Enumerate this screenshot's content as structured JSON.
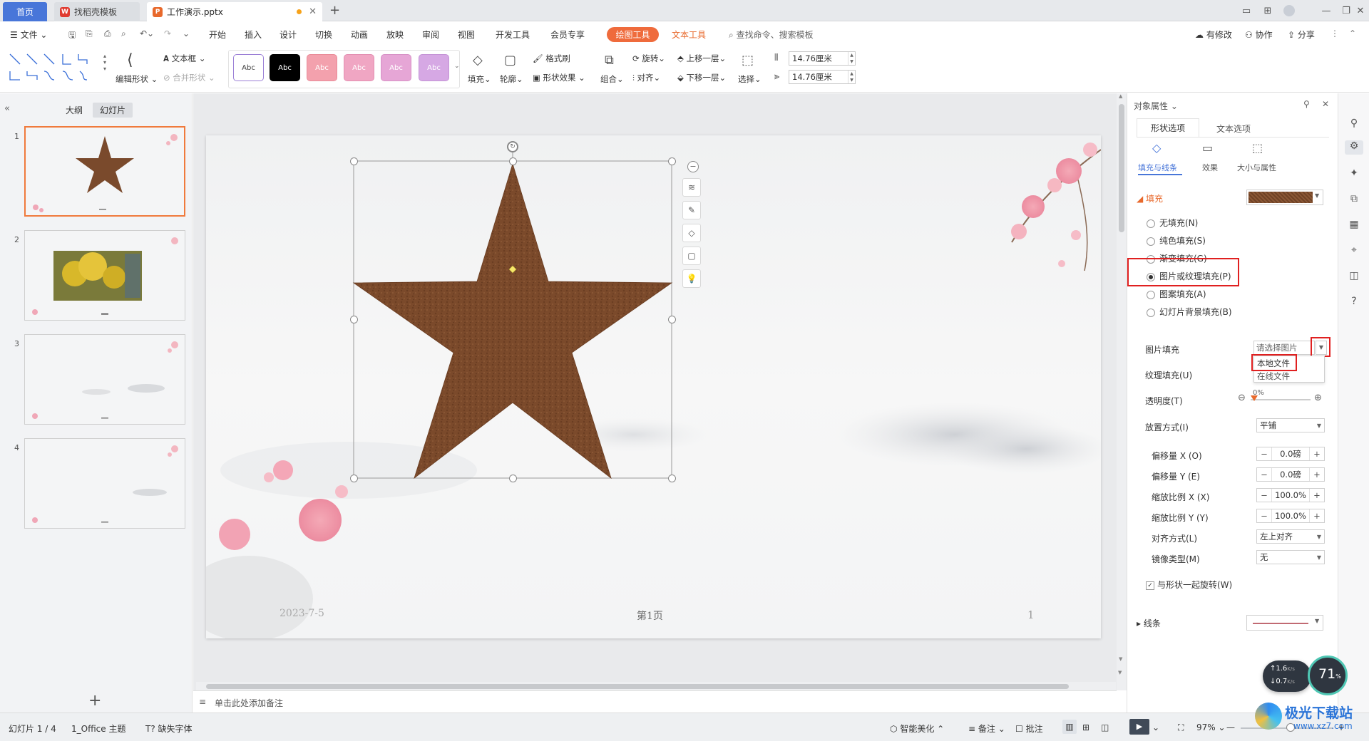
{
  "tabs": {
    "home": "首页",
    "template": "找稻壳模板",
    "doc": "工作演示.pptx",
    "add": "+"
  },
  "menu": {
    "file": "文件",
    "items": [
      "开始",
      "插入",
      "设计",
      "切换",
      "动画",
      "放映",
      "审阅",
      "视图",
      "开发工具",
      "会员专享"
    ],
    "drawing_tools": "绘图工具",
    "text_tools": "文本工具",
    "search_placeholder": "查找命令、搜索模板",
    "modified": "有修改",
    "collab": "协作",
    "share": "分享"
  },
  "ribbon": {
    "edit_shape": "编辑形状",
    "textbox": "文本框",
    "merge_shape": "合并形状",
    "styles": [
      "Abc",
      "Abc",
      "Abc",
      "Abc",
      "Abc",
      "Abc"
    ],
    "fill": "填充",
    "outline": "轮廓",
    "format_brush": "格式刷",
    "shape_effect": "形状效果",
    "group": "组合",
    "rotate": "旋转",
    "align": "对齐",
    "bring_forward": "上移一层",
    "send_backward": "下移一层",
    "select": "选择",
    "height": "14.76厘米",
    "width": "14.76厘米"
  },
  "left_panel": {
    "outline_tab": "大纲",
    "slides_tab": "幻灯片",
    "slide_numbers": [
      "1",
      "2",
      "3",
      "4"
    ],
    "add": "+"
  },
  "slide": {
    "date": "2023-7-5",
    "page_label": "第1页",
    "page_number": "1"
  },
  "notes": {
    "placeholder": "单击此处添加备注"
  },
  "right_panel": {
    "title": "对象属性",
    "tab_shape": "形状选项",
    "tab_text": "文本选项",
    "sub_fill_line": "填充与线条",
    "sub_effect": "效果",
    "sub_size": "大小与属性",
    "fill_section": "填充",
    "fill_options": [
      "无填充(N)",
      "纯色填充(S)",
      "渐变填充(G)",
      "图片或纹理填充(P)",
      "图案填充(A)",
      "幻灯片背景填充(B)"
    ],
    "picture_fill": "图片填充",
    "picture_fill_value": "请选择图片",
    "dropdown_local": "本地文件",
    "dropdown_online": "在线文件",
    "texture_fill": "纹理填充(U)",
    "transparency": "透明度(T)",
    "transparency_value": "0%",
    "placement": "放置方式(I)",
    "placement_value": "平铺",
    "offset_x": "偏移量 X (O)",
    "offset_x_value": "0.0磅",
    "offset_y": "偏移量 Y (E)",
    "offset_y_value": "0.0磅",
    "scale_x": "缩放比例 X (X)",
    "scale_x_value": "100.0%",
    "scale_y": "缩放比例 Y (Y)",
    "scale_y_value": "100.0%",
    "alignment": "对齐方式(L)",
    "alignment_value": "左上对齐",
    "mirror": "镜像类型(M)",
    "mirror_value": "无",
    "rotate_with_shape": "与形状一起旋转(W)",
    "line_section": "线条"
  },
  "net_widget": {
    "up": "1.6",
    "down": "0.7",
    "unit": "K/s",
    "percent": "71",
    "pct_sign": "%"
  },
  "statusbar": {
    "slide_info": "幻灯片 1 / 4",
    "theme": "1_Office 主题",
    "missing_font": "缺失字体",
    "smart_beautify": "智能美化",
    "notes": "备注",
    "comments": "批注",
    "zoom": "97%"
  },
  "watermark": {
    "brand": "极光下载站",
    "url": "www.xz7.com"
  },
  "colors": {
    "accent_blue": "#4876d9",
    "accent_orange": "#ef6b3c",
    "star_brown": "#7a4a2c",
    "highlight_red": "#e02020"
  }
}
